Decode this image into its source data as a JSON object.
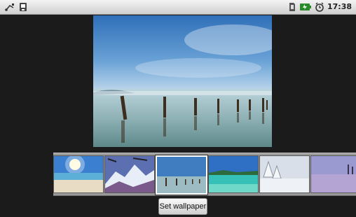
{
  "status_bar": {
    "left_icons": [
      "usb-debug-icon",
      "usb-connected-icon"
    ],
    "right_icons": [
      "sd-card-icon",
      "battery-charging-icon",
      "alarm-clock-icon"
    ],
    "time": "17:38"
  },
  "preview": {
    "image": "lake-with-wooden-posts-wallpaper"
  },
  "gallery": {
    "thumbnails": [
      {
        "name": "sunny-beach-wallpaper",
        "selected": false
      },
      {
        "name": "snowy-mountains-wallpaper",
        "selected": false
      },
      {
        "name": "lake-posts-wallpaper",
        "selected": true
      },
      {
        "name": "tropical-lagoon-wallpaper",
        "selected": false
      },
      {
        "name": "winter-trees-wallpaper",
        "selected": false
      },
      {
        "name": "purple-sunset-lake-wallpaper",
        "selected": false
      }
    ]
  },
  "actions": {
    "set_wallpaper_label": "Set wallpaper"
  },
  "colors": {
    "background": "#1b1b1b",
    "strip": "#9a9a9a",
    "status_bar": "#e6e6e6"
  }
}
